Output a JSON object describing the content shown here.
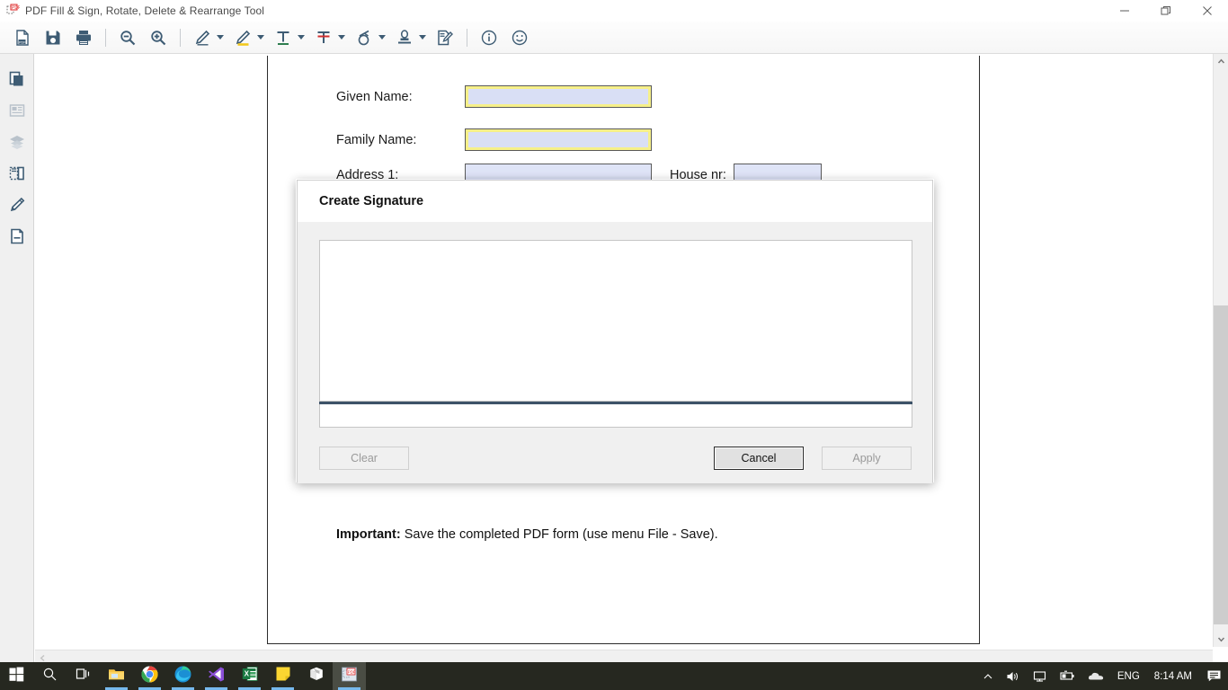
{
  "window": {
    "title": "PDF Fill & Sign, Rotate, Delete & Rearrange Tool",
    "app_icon": "pdf-app-icon",
    "controls": {
      "minimize": "minimize-icon",
      "restore": "restore-icon",
      "close": "close-icon"
    }
  },
  "toolbar": {
    "items": [
      {
        "name": "new-pdf-button",
        "icon": "document-pdf-icon",
        "caret": false
      },
      {
        "name": "save-button",
        "icon": "save-floppy-icon",
        "caret": false
      },
      {
        "name": "print-button",
        "icon": "printer-icon",
        "caret": false
      },
      {
        "name": "zoom-out-button",
        "icon": "zoom-out-icon",
        "caret": false
      },
      {
        "name": "zoom-in-button",
        "icon": "zoom-in-icon",
        "caret": false
      },
      {
        "name": "pencil-tool-button",
        "icon": "pencil-icon",
        "caret": true
      },
      {
        "name": "highlighter-tool-button",
        "icon": "highlighter-icon",
        "caret": true
      },
      {
        "name": "add-text-button",
        "icon": "text-underline-icon",
        "caret": true
      },
      {
        "name": "strikethrough-button",
        "icon": "text-strikethrough-icon",
        "caret": true
      },
      {
        "name": "shapes-tool-button",
        "icon": "shapes-circle-icon",
        "caret": true
      },
      {
        "name": "stamp-tool-button",
        "icon": "stamp-icon",
        "caret": true
      },
      {
        "name": "sign-document-button",
        "icon": "sign-document-icon",
        "caret": false
      },
      {
        "name": "info-button",
        "icon": "info-circle-icon",
        "caret": false
      },
      {
        "name": "emoji-button",
        "icon": "smiley-face-icon",
        "caret": false
      }
    ]
  },
  "sidebar": {
    "items": [
      {
        "name": "sidebar-item-pages",
        "icon": "pages-copy-icon"
      },
      {
        "name": "sidebar-item-bookmarks",
        "icon": "article-list-icon"
      },
      {
        "name": "sidebar-item-layers",
        "icon": "layers-stack-icon"
      },
      {
        "name": "sidebar-item-crop",
        "icon": "crop-resize-icon"
      },
      {
        "name": "sidebar-item-annotate",
        "icon": "pencil-edit-icon"
      },
      {
        "name": "sidebar-item-attachments",
        "icon": "document-page-icon"
      }
    ]
  },
  "document": {
    "fields": [
      {
        "label": "Given Name:",
        "value": "",
        "highlighted": true
      },
      {
        "label": "Family Name:",
        "value": "",
        "highlighted": true
      },
      {
        "label": "Address 1:",
        "value": "",
        "highlighted": false
      },
      {
        "label": "House nr:",
        "value": "",
        "highlighted": false
      }
    ],
    "note_bold": "Important:",
    "note_text": " Save the completed PDF form (use menu File - Save)."
  },
  "dialog": {
    "title": "Create Signature",
    "canvas_placeholder": "",
    "signature_value": "",
    "buttons": {
      "clear": {
        "label": "Clear",
        "enabled": false
      },
      "cancel": {
        "label": "Cancel",
        "enabled": true
      },
      "apply": {
        "label": "Apply",
        "enabled": false
      }
    },
    "baseline_color": "#3d5368"
  },
  "scrollbars": {
    "vertical": {
      "up_arrow": "chevron-up-icon",
      "down_arrow": "chevron-down-icon"
    },
    "horizontal": {
      "left_arrow": "chevron-left-icon"
    }
  },
  "taskbar": {
    "items": [
      {
        "name": "start-button",
        "icon": "windows-logo-icon",
        "active": false,
        "running": false
      },
      {
        "name": "search-button",
        "icon": "search-icon",
        "active": false,
        "running": false
      },
      {
        "name": "task-view-button",
        "icon": "task-view-icon",
        "active": false,
        "running": false
      },
      {
        "name": "file-explorer-button",
        "icon": "folder-icon",
        "active": false,
        "running": true
      },
      {
        "name": "chrome-button",
        "icon": "chrome-icon",
        "active": false,
        "running": true
      },
      {
        "name": "edge-button",
        "icon": "edge-icon",
        "active": false,
        "running": true
      },
      {
        "name": "vscode-button",
        "icon": "vscode-icon",
        "active": false,
        "running": true
      },
      {
        "name": "excel-button",
        "icon": "excel-icon",
        "active": false,
        "running": true
      },
      {
        "name": "sticky-notes-button",
        "icon": "sticky-note-icon",
        "active": false,
        "running": true
      },
      {
        "name": "package-button",
        "icon": "package-box-icon",
        "active": false,
        "running": false
      },
      {
        "name": "pdf-tool-button",
        "icon": "pdf-app-icon",
        "active": true,
        "running": true
      }
    ],
    "tray": {
      "overflow": "chevron-up-icon",
      "volume": "speaker-icon",
      "network": "monitor-network-icon",
      "battery": "battery-icon",
      "onedrive": "cloud-icon",
      "language": "ENG",
      "clock": "8:14 AM",
      "notifications": "notification-icon"
    }
  },
  "colors": {
    "accent_blue": "#3e5c74",
    "field_fill": "#d9dff5",
    "field_highlight": "#f6f089",
    "taskbar_bg": "#262820"
  }
}
